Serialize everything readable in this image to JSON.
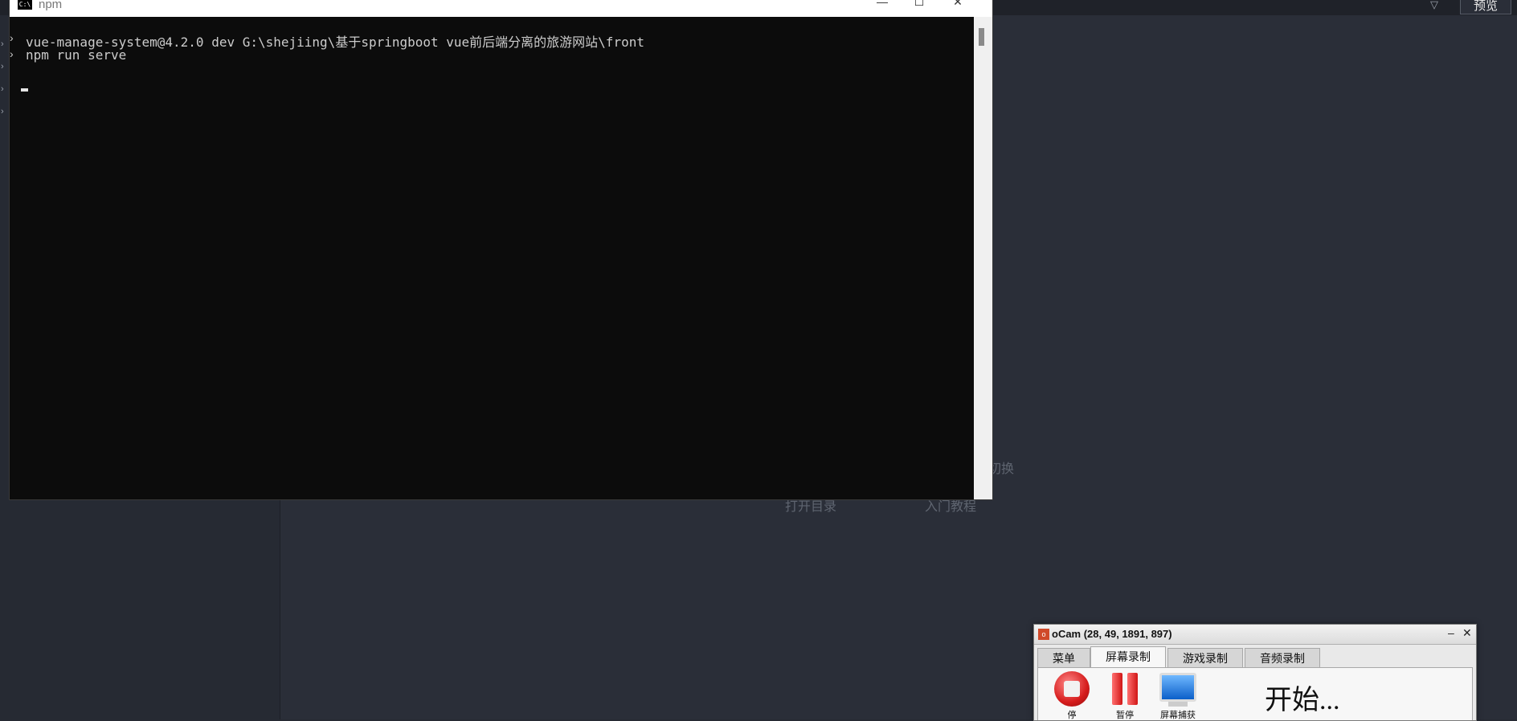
{
  "ide": {
    "preview_label": "预览",
    "hint_switch": "切换",
    "hint_open_dir": "打开目录",
    "hint_tutorial": "入门教程"
  },
  "terminal": {
    "title": "npm",
    "icon_text": "C:\\",
    "lines": [
      "vue-manage-system@4.2.0 dev G:\\shejiing\\基于springboot vue前后端分离的旅游网站\\front",
      "npm run serve"
    ],
    "minimize": "—",
    "maximize": "☐",
    "close": "✕"
  },
  "ocam": {
    "title": "oCam (28, 49, 1891, 897)",
    "minimize": "–",
    "close": "✕",
    "tabs": [
      "菜单",
      "屏幕录制",
      "游戏录制",
      "音频录制"
    ],
    "active_tab": "屏幕录制",
    "buttons": [
      "停",
      "暂停",
      "屏幕捕获"
    ],
    "status": "开始..."
  },
  "colors": {
    "ide_bg": "#262a33",
    "terminal_bg": "#0c0c0c",
    "terminal_text": "#cccccc",
    "record_red": "#d61c1c"
  }
}
